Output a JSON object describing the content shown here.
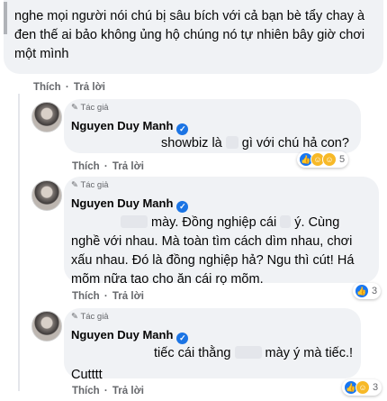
{
  "top_comment": {
    "text": "nghe mọi người nói chú bị sâu bích với cả bạn bè tẩy chay à đen thế ai bảo không ủng hộ chúng nó tự nhiên bây giờ chơi một mình",
    "like_label": "Thích",
    "reply_label": "Trả lời"
  },
  "replies": [
    {
      "author_tag": "Tác giả",
      "author_name": "Nguyen Duy Manh",
      "line1": "showbiz là",
      "line1b": "gì với chú hả con?",
      "like_label": "Thích",
      "reply_label": "Trả lời",
      "reaction_count": "5"
    },
    {
      "author_tag": "Tác giả",
      "author_name": "Nguyen Duy Manh",
      "line1a": "mày. Đồng nghiệp cái",
      "line1b": "ý. Cùng",
      "line2": "nghề với nhau. Mà toàn tìm cách dìm nhau, chơi",
      "line3": "xấu nhau. Đó là đồng nghiệp hả? Ngu thì cút! Há",
      "line4": "mõm nữa tao cho ăn cái rọ mõm.",
      "like_label": "Thích",
      "reply_label": "Trả lời",
      "reaction_count": "3"
    },
    {
      "author_tag": "Tác giả",
      "author_name": "Nguyen Duy Manh",
      "line1a": "tiếc cái thằng",
      "line1b": "mày ý mà tiếc.!",
      "line2": "Cutttt",
      "like_label": "Thích",
      "reply_label": "Trả lời",
      "reaction_count": "3"
    }
  ],
  "icons": {
    "author_badge": "pencil-icon",
    "verified": "verified-check-icon",
    "like": "like-reaction-icon",
    "haha": "haha-reaction-icon"
  },
  "colors": {
    "bubble": "#f0f2f5",
    "meta_text": "#65676b",
    "verified": "#1b74e4",
    "like": "#1877f2"
  }
}
